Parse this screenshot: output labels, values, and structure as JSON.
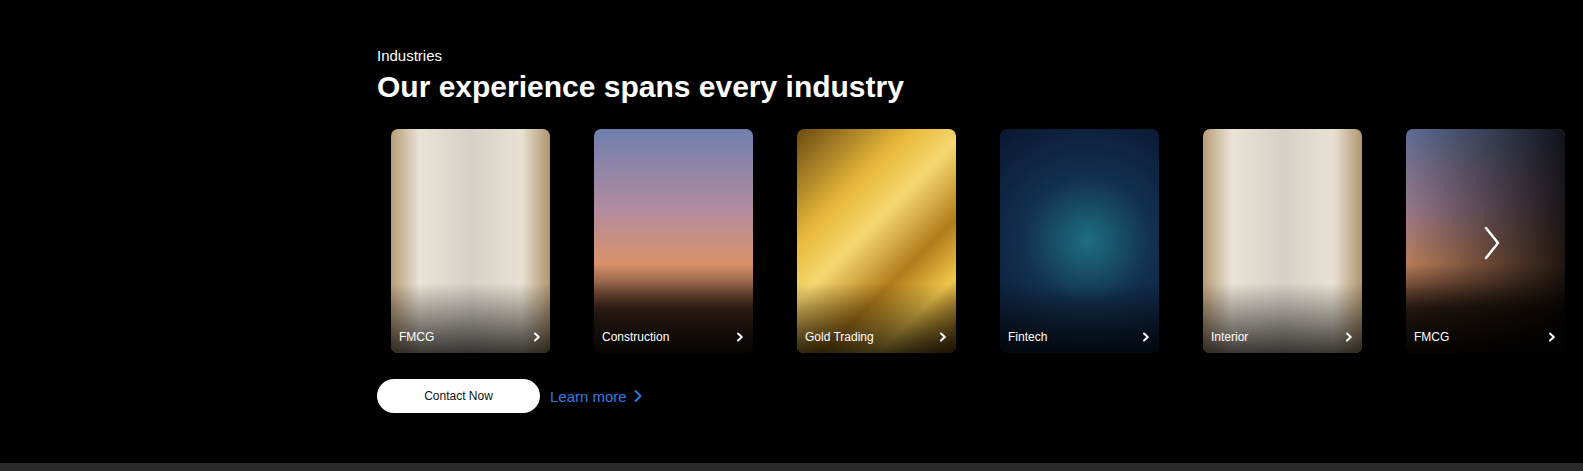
{
  "section": {
    "label": "Industries",
    "title": "Our experience spans every industry"
  },
  "cards": [
    {
      "label": "FMCG",
      "dimmed": false
    },
    {
      "label": "Construction",
      "dimmed": false
    },
    {
      "label": "Gold Trading",
      "dimmed": false
    },
    {
      "label": "Fintech",
      "dimmed": false
    },
    {
      "label": "Interior",
      "dimmed": false
    },
    {
      "label": "FMCG",
      "dimmed": true
    }
  ],
  "actions": {
    "primary": "Contact Now",
    "link": "Learn more"
  }
}
